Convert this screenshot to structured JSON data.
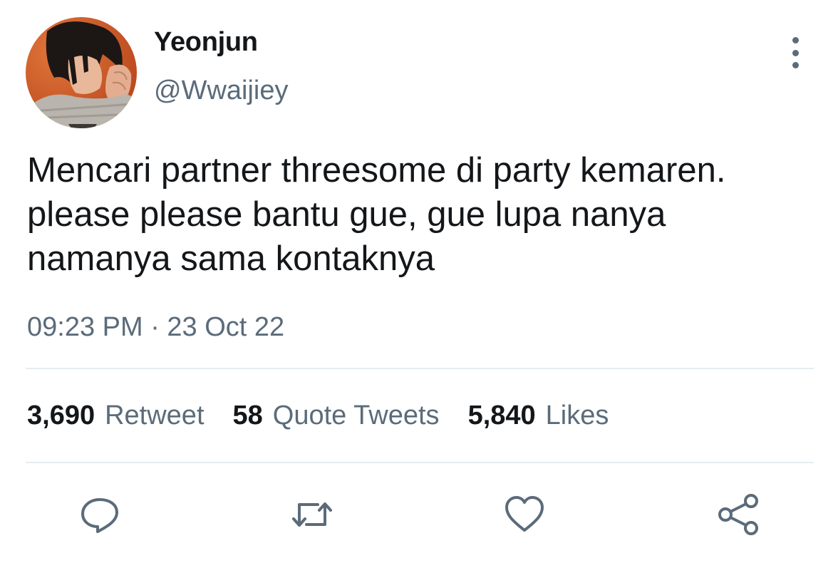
{
  "user": {
    "display_name": "Yeonjun",
    "handle": "@Wwaijiey",
    "avatar_icon": "profile-photo"
  },
  "tweet": {
    "text": "Mencari partner threesome di party kemaren.\nplease please bantu gue, gue lupa nanya\nnamanya sama kontaknya",
    "timestamp": "09:23 PM · 23 Oct 22"
  },
  "stats": {
    "retweets": {
      "count": "3,690",
      "label": "Retweet"
    },
    "quote_tweets": {
      "count": "58",
      "label": "Quote Tweets"
    },
    "likes": {
      "count": "5,840",
      "label": "Likes"
    }
  },
  "actions": {
    "reply": {
      "icon": "reply-icon"
    },
    "retweet": {
      "icon": "retweet-icon"
    },
    "like": {
      "icon": "heart-icon"
    },
    "share": {
      "icon": "share-icon"
    }
  },
  "colors": {
    "text_primary": "#14171a",
    "text_secondary": "#5b6b7a",
    "divider": "#e6ecf0",
    "icon": "#5b6b7a"
  }
}
